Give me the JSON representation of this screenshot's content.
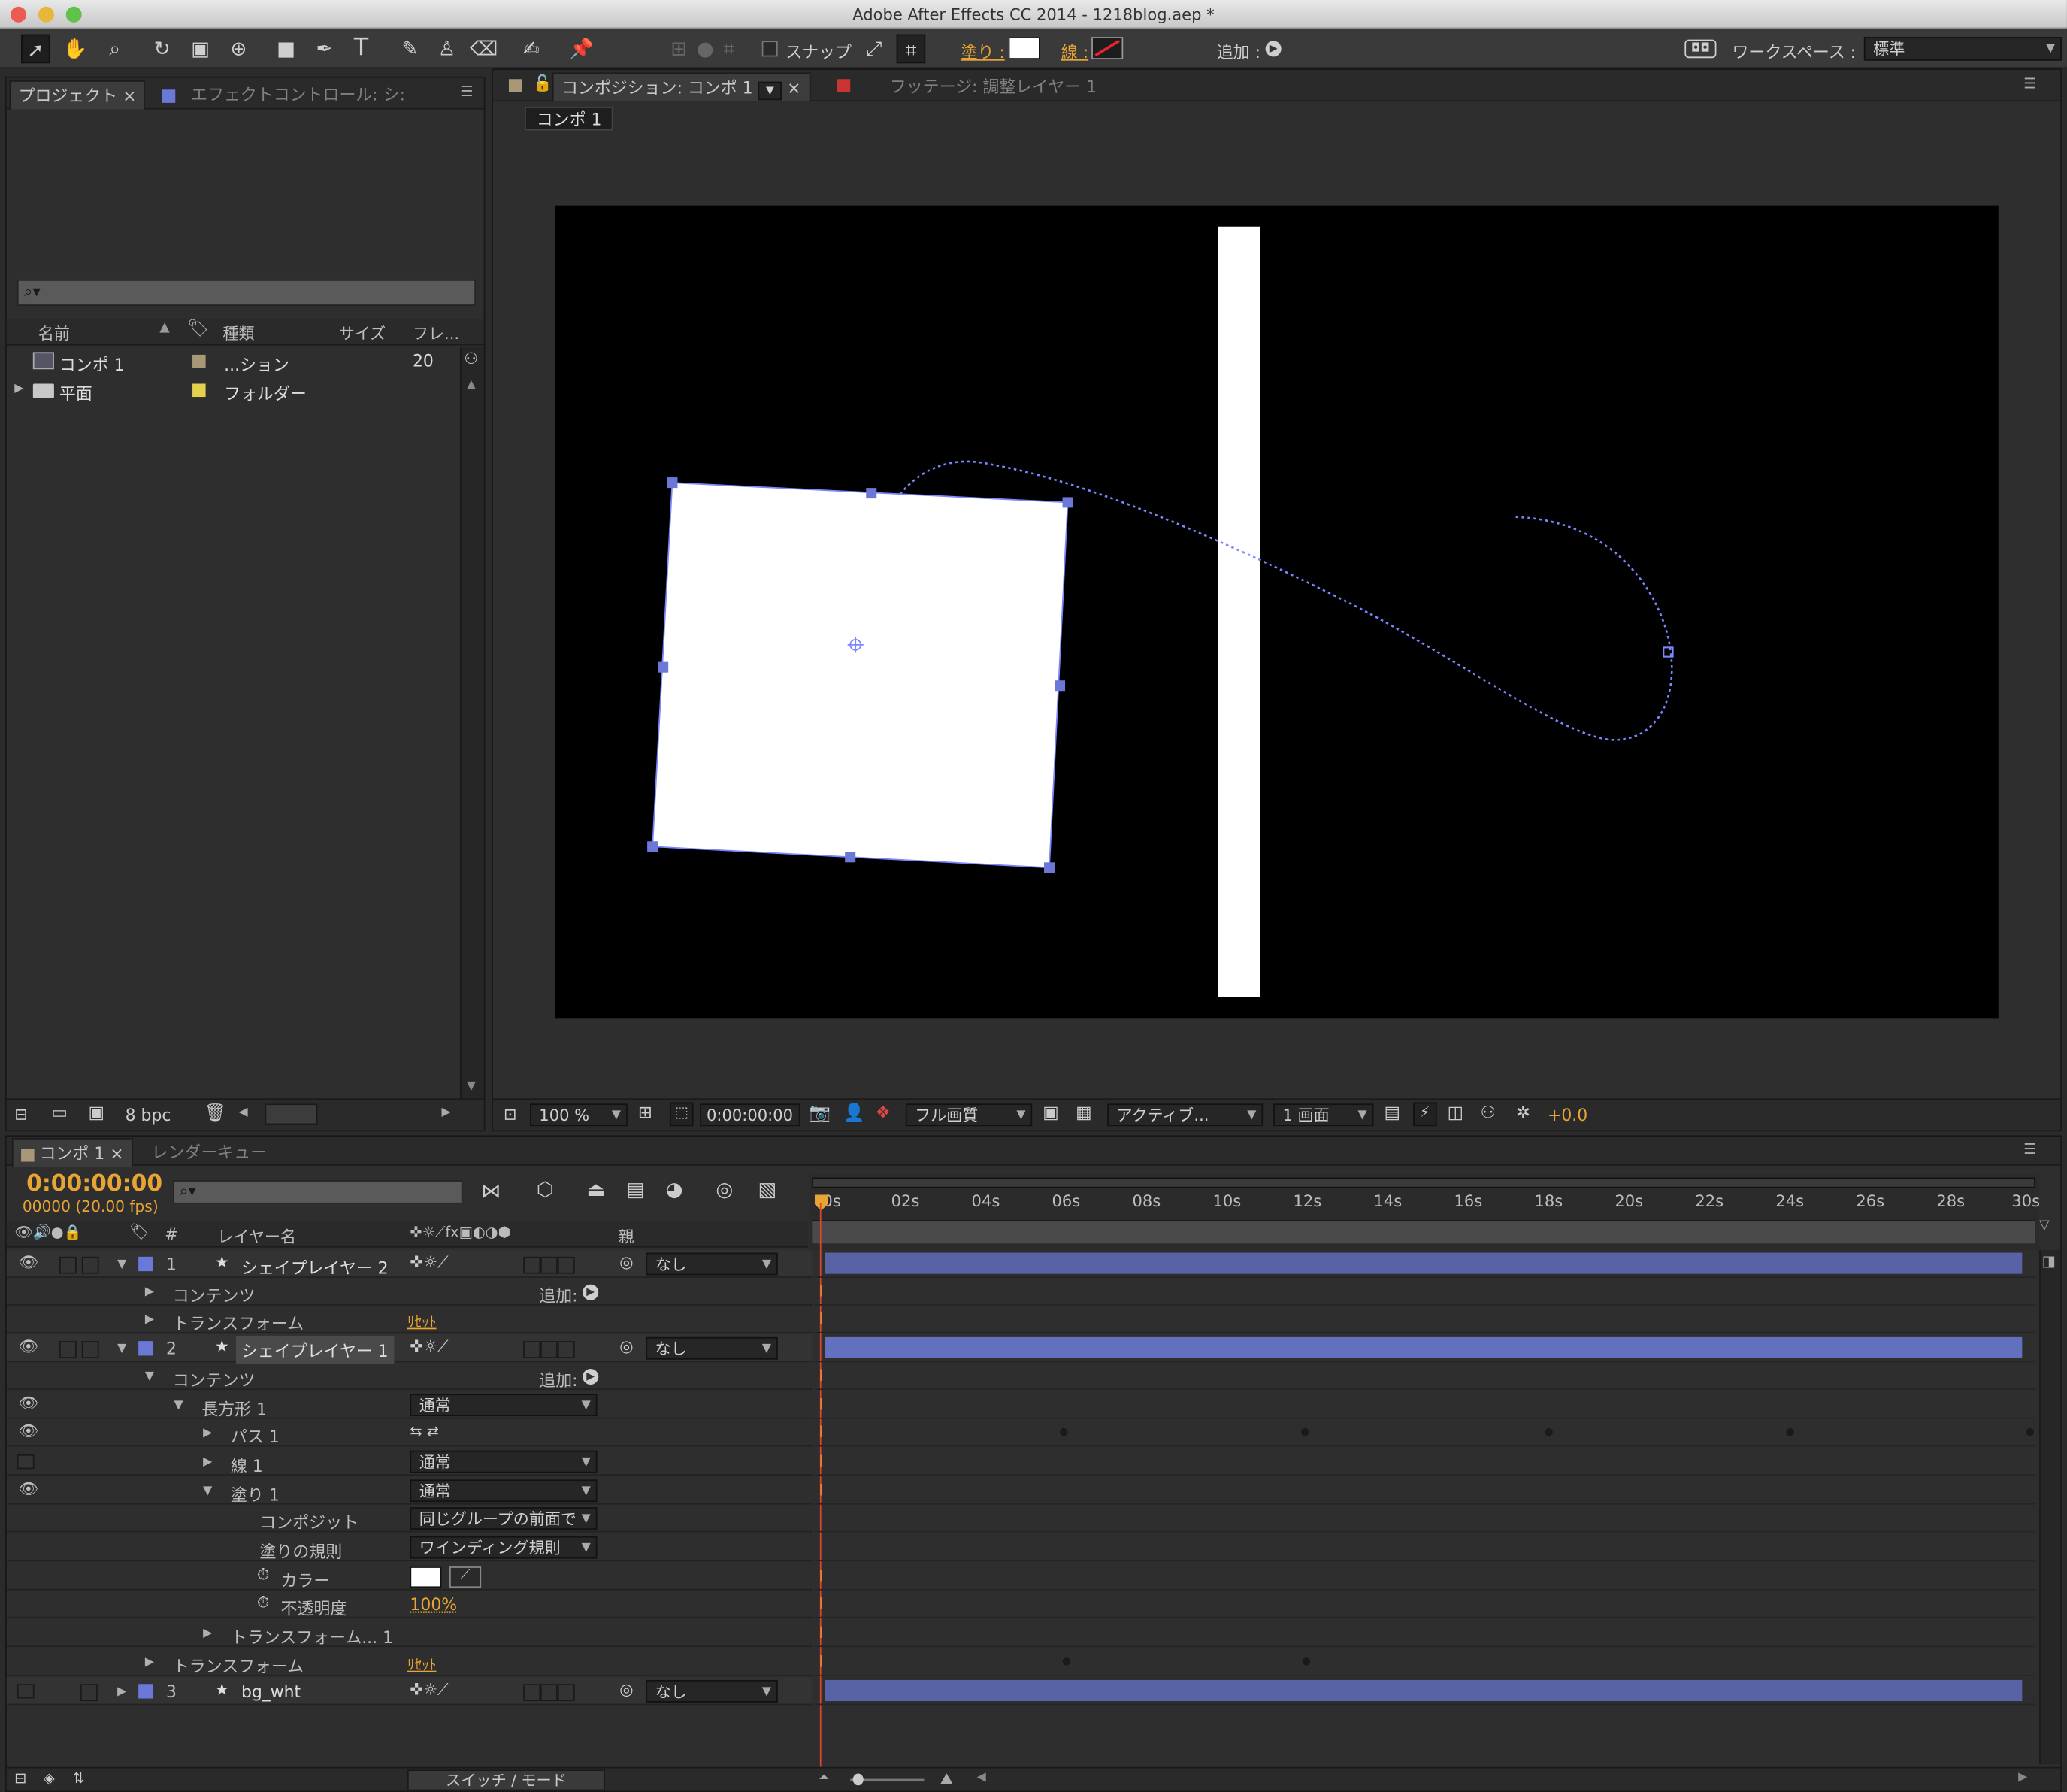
{
  "window": {
    "title": "Adobe After Effects CC 2014 - 1218blog.aep *"
  },
  "colors": {
    "accent": "#e8a434",
    "layer_label": "#6b78d8",
    "bar": "#5863a6",
    "path": "#7b86ff"
  },
  "toolbar": {
    "snap_label": "スナップ",
    "fill_label": "塗り :",
    "stroke_label": "線 :",
    "add_label": "追加 :",
    "workspace_label": "ワークスペース :",
    "workspace_value": "標準",
    "tools": [
      "selection-tool-icon",
      "hand-tool-icon",
      "zoom-tool-icon",
      "rotation-tool-icon",
      "camera-tool-icon",
      "pan-behind-tool-icon",
      "rectangle-tool-icon",
      "pen-tool-icon",
      "type-tool-icon",
      "brush-tool-icon",
      "clone-stamp-tool-icon",
      "eraser-tool-icon",
      "roto-brush-tool-icon",
      "puppet-pin-tool-icon"
    ]
  },
  "project_panel": {
    "tab_project": "プロジェクト",
    "tab_effects": "エフェクトコントロール: シ:",
    "search_placeholder": "",
    "columns": {
      "name": "名前",
      "type": "種類",
      "size": "サイズ",
      "frames": "フレ..."
    },
    "items": [
      {
        "name": "コンポ 1",
        "type": "...ション",
        "frames": "20",
        "label_color": "#a89878"
      },
      {
        "name": "平面",
        "type": "フォルダー",
        "frames": "",
        "label_color": "#e2d04e"
      }
    ],
    "bpc": "8 bpc"
  },
  "comp_panel": {
    "tab_comp": "コンポジション: コンポ 1",
    "tab_footage": "フッテージ: 調整レイヤー 1",
    "breadcrumb": "コンポ 1",
    "zoom": "100 %",
    "timecode": "0:00:00:00",
    "resolution": "フル画質",
    "camera": "アクティブ...",
    "views": "1 画面",
    "exposure": "+0.0"
  },
  "timeline": {
    "tab_comp": "コンポ 1",
    "tab_render": "レンダーキュー",
    "timecode": "0:00:00:00",
    "frame_info": "00000 (20.00 fps)",
    "header": {
      "number": "#",
      "layer_name": "レイヤー名",
      "parent": "親"
    },
    "ruler": [
      "0s",
      "02s",
      "04s",
      "06s",
      "08s",
      "10s",
      "12s",
      "14s",
      "16s",
      "18s",
      "20s",
      "22s",
      "24s",
      "26s",
      "28s",
      "30s"
    ],
    "rows": {
      "l1_num": "1",
      "l1_name": "シェイプレイヤー 2",
      "l1_parent": "なし",
      "l1_contents": "コンテンツ",
      "l1_add": "追加:",
      "l1_transform": "トランスフォーム",
      "l1_reset": "ﾘｾｯﾄ",
      "l2_num": "2",
      "l2_name": "シェイプレイヤー 1",
      "l2_parent": "なし",
      "l2_contents": "コンテンツ",
      "l2_add": "追加:",
      "rect": "長方形 1",
      "rect_mode": "通常",
      "path": "パス 1",
      "stroke": "線 1",
      "stroke_mode": "通常",
      "fill": "塗り 1",
      "fill_mode": "通常",
      "composite": "コンポジット",
      "composite_value": "同じグループの前面で",
      "fill_rule": "塗りの規則",
      "fill_rule_value": "ワインディング規則",
      "color": "カラー",
      "opacity": "不透明度",
      "opacity_value": "100%",
      "transform_group": "トランスフォーム... 1",
      "l2_transform": "トランスフォーム",
      "l2_reset": "ﾘｾｯﾄ",
      "l3_num": "3",
      "l3_name": "bg_wht",
      "l3_parent": "なし"
    },
    "switch_mode": "スイッチ / モード"
  }
}
